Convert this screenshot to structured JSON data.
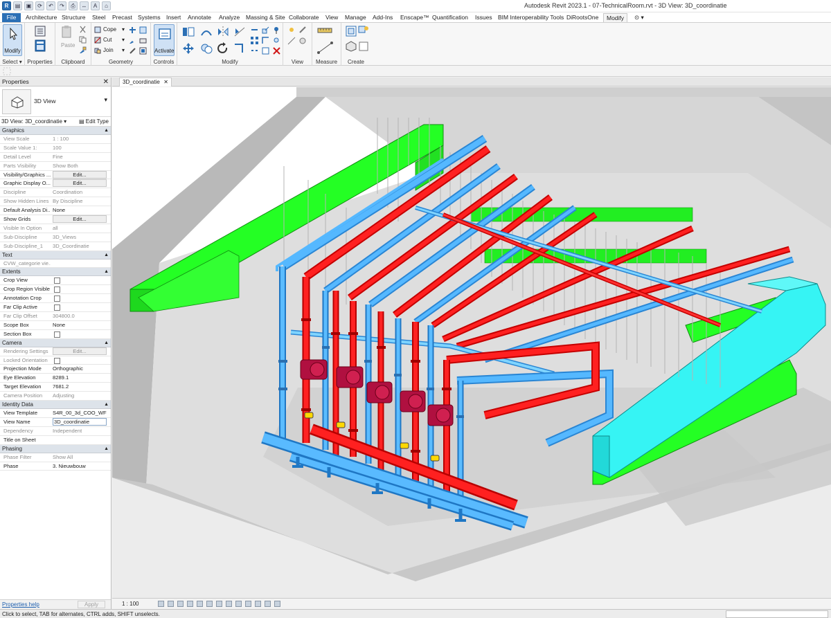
{
  "window": {
    "title": "Autodesk Revit 2023.1 - 07-TechnicalRoom.rvt - 3D View: 3D_coordinatie"
  },
  "menu_tabs": [
    "File",
    "Architecture",
    "Structure",
    "Steel",
    "Precast",
    "Systems",
    "Insert",
    "Annotate",
    "Analyze",
    "Massing & Site",
    "Collaborate",
    "View",
    "Manage",
    "Add-Ins",
    "Enscape™",
    "Quantification",
    "Issues",
    "BIM Interoperability Tools",
    "DiRootsOne",
    "Modify"
  ],
  "active_tab": "Modify",
  "ribbon": {
    "panels": [
      "Select",
      "Properties",
      "Clipboard",
      "Geometry",
      "Controls",
      "Modify",
      "View",
      "Measure",
      "Create"
    ],
    "buttons": {
      "modify": "Modify",
      "paste": "Paste",
      "activate": "Activate",
      "cope": "Cope",
      "cut": "Cut",
      "join": "Join"
    }
  },
  "properties": {
    "header": "Properties",
    "close": "✕",
    "type_name": "3D View",
    "instance_selector": "3D View: 3D_coordinatie",
    "edit_type": "Edit Type",
    "groups": [
      {
        "name": "Graphics",
        "rows": [
          {
            "k": "View Scale",
            "v": "1 : 100",
            "dim": true
          },
          {
            "k": "Scale Value    1:",
            "v": "100",
            "dim": true
          },
          {
            "k": "Detail Level",
            "v": "Fine",
            "dim": true
          },
          {
            "k": "Parts Visibility",
            "v": "Show Both",
            "dim": true
          },
          {
            "k": "Visibility/Graphics ...",
            "v": "Edit...",
            "btn": true
          },
          {
            "k": "Graphic Display O...",
            "v": "Edit...",
            "btn": true
          },
          {
            "k": "Discipline",
            "v": "Coordination",
            "dim": true
          },
          {
            "k": "Show Hidden Lines",
            "v": "By Discipline",
            "dim": true
          },
          {
            "k": "Default Analysis Di...",
            "v": "None"
          },
          {
            "k": "Show Grids",
            "v": "Edit...",
            "btn": true
          },
          {
            "k": "Visible In Option",
            "v": "all",
            "dim": true
          },
          {
            "k": "Sub-Discipline",
            "v": "3D_Views",
            "dim": true
          },
          {
            "k": "Sub-Discipline_1",
            "v": "3D_Coordinatie",
            "dim": true
          }
        ]
      },
      {
        "name": "Text",
        "rows": [
          {
            "k": "CVW_categorie vie...",
            "v": "",
            "dim": true
          }
        ]
      },
      {
        "name": "Extents",
        "rows": [
          {
            "k": "Crop View",
            "cb": true
          },
          {
            "k": "Crop Region Visible",
            "cb": true
          },
          {
            "k": "Annotation Crop",
            "cb": true
          },
          {
            "k": "Far Clip Active",
            "cb": true
          },
          {
            "k": "Far Clip Offset",
            "v": "304800.0",
            "dim": true
          },
          {
            "k": "Scope Box",
            "v": "None"
          },
          {
            "k": "Section Box",
            "cb": true
          }
        ]
      },
      {
        "name": "Camera",
        "rows": [
          {
            "k": "Rendering Settings",
            "v": "Edit...",
            "btn": true,
            "dim": true
          },
          {
            "k": "Locked Orientation",
            "cb": true,
            "dim": true
          },
          {
            "k": "Projection Mode",
            "v": "Orthographic"
          },
          {
            "k": "Eye Elevation",
            "v": "8289.1"
          },
          {
            "k": "Target Elevation",
            "v": "7681.2"
          },
          {
            "k": "Camera Position",
            "v": "Adjusting",
            "dim": true
          }
        ]
      },
      {
        "name": "Identity Data",
        "rows": [
          {
            "k": "View Template",
            "v": "S4R_00_3d_COO_WF"
          },
          {
            "k": "View Name",
            "v": "3D_coordinatie",
            "box": true
          },
          {
            "k": "Dependency",
            "v": "Independent",
            "dim": true
          },
          {
            "k": "Title on Sheet",
            "v": ""
          }
        ]
      },
      {
        "name": "Phasing",
        "rows": [
          {
            "k": "Phase Filter",
            "v": "Show All",
            "dim": true
          },
          {
            "k": "Phase",
            "v": "3. Nieuwbouw"
          }
        ]
      }
    ],
    "help": "Properties help",
    "apply": "Apply"
  },
  "view_tab": {
    "label": "3D_coordinatie",
    "close": "✕"
  },
  "view_bar": {
    "scale": "1 : 100"
  },
  "status": {
    "message": "Click to select, TAB for alternates, CTRL adds, SHIFT unselects."
  },
  "colors": {
    "supply": "#ff1a1a",
    "return": "#33aaff",
    "duct_green": "#22ff22",
    "duct_cyan": "#33f0f0",
    "pump": "#b0103a",
    "ribbon_blue": "#2b6fb5"
  },
  "icons": [
    "revit-logo-icon",
    "save-icon",
    "undo-icon",
    "redo-icon",
    "print-icon",
    "measure-icon",
    "text-icon",
    "modify-cursor-icon",
    "properties-icon",
    "paste-icon",
    "cope-icon",
    "cut-icon",
    "join-icon",
    "activate-icon",
    "align-icon",
    "move-icon",
    "rotate-icon",
    "3d-view-icon",
    "measure-distance-icon",
    "create-group-icon"
  ]
}
